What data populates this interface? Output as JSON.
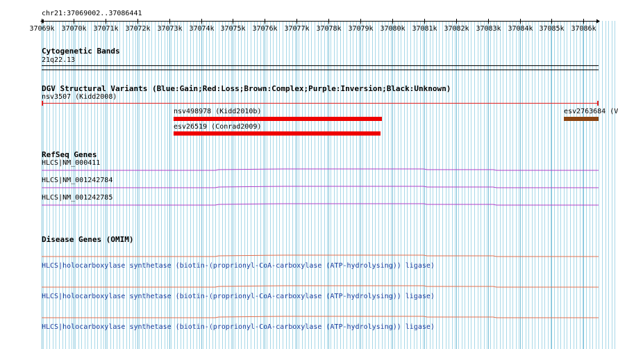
{
  "ruler": {
    "label": "chr21:37069002..37086441",
    "ticks": [
      "37069k",
      "37070k",
      "37071k",
      "37072k",
      "37073k",
      "37074k",
      "37075k",
      "37076k",
      "37077k",
      "37078k",
      "37079k",
      "37080k",
      "37081k",
      "37082k",
      "37083k",
      "37084k",
      "37085k",
      "37086k"
    ]
  },
  "tracks": {
    "cytoband": {
      "title": "Cytogenetic Bands",
      "band": "21q22.13"
    },
    "dgv": {
      "title": "DGV Structural Variants (Blue:Gain;Red:Loss;Brown:Complex;Purple:Inversion;Black:Unknown)",
      "features": [
        {
          "label": "nsv3507 (Kidd2008)",
          "color": "#e02020",
          "kind": "thin"
        },
        {
          "label": "nsv498978 (Kidd2010b)",
          "color": "#ee0000",
          "kind": "thick"
        },
        {
          "label": "esv26519 (Conrad2009)",
          "color": "#ee0000",
          "kind": "thick"
        },
        {
          "label": "esv2763684 (V",
          "color": "#8b4513",
          "kind": "thick"
        }
      ]
    },
    "refseq": {
      "title": "RefSeq Genes",
      "genes": [
        "HLCS|NM_000411",
        "HLCS|NM_001242784",
        "HLCS|NM_001242785"
      ],
      "color": "#b040c8"
    },
    "omim": {
      "title": "Disease Genes (OMIM)",
      "genes": [
        "HLCS|holocarboxylase synthetase (biotin-(proprionyl-CoA-carboxylase (ATP-hydrolysing)) ligase)",
        "HLCS|holocarboxylase synthetase (biotin-(proprionyl-CoA-carboxylase (ATP-hydrolysing)) ligase)",
        "HLCS|holocarboxylase synthetase (biotin-(proprionyl-CoA-carboxylase (ATP-hydrolysing)) ligase)"
      ],
      "color": "#e07050"
    }
  },
  "colors": {
    "grid": "#a8d8e8",
    "grid_major": "#7cc0d8"
  }
}
